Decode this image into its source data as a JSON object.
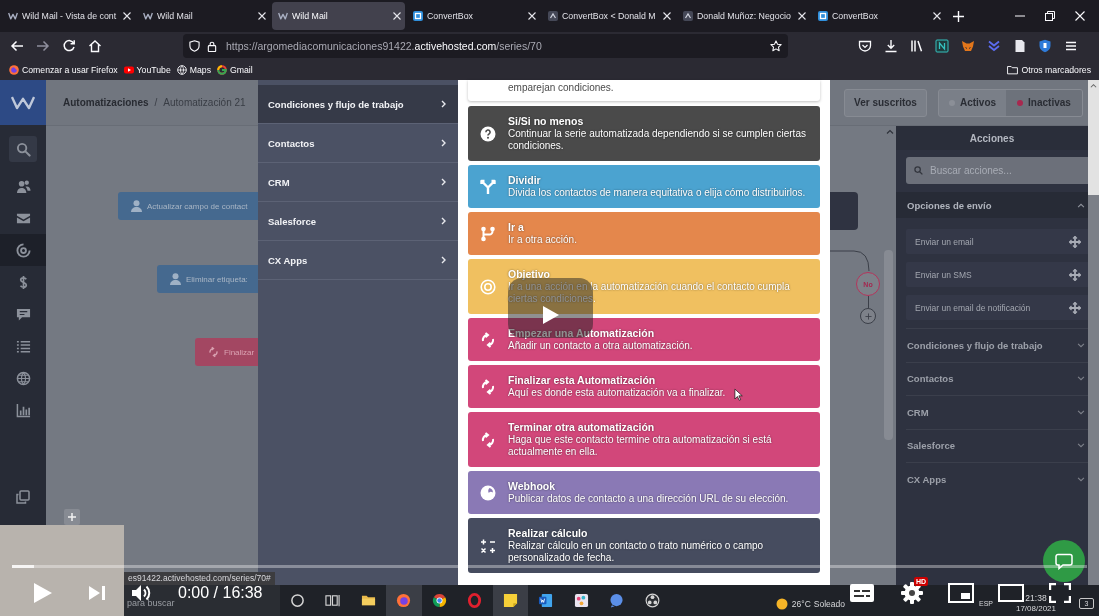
{
  "browser": {
    "tabs": [
      {
        "title": "Wild Mail - Vista de cont",
        "kind": "logo",
        "selected": false
      },
      {
        "title": "Wild Mail",
        "kind": "logo",
        "selected": false
      },
      {
        "title": "Wild Mail",
        "kind": "logo",
        "selected": true
      },
      {
        "title": "ConvertBox",
        "kind": "box",
        "selected": false
      },
      {
        "title": "ConvertBox < Donald M",
        "kind": "page",
        "selected": false
      },
      {
        "title": "Donald Muñoz: Negocio",
        "kind": "page",
        "selected": false
      },
      {
        "title": "ConvertBox",
        "kind": "box",
        "selected": false
      }
    ],
    "address": {
      "url": [
        {
          "text": "https://argomediacomunicaciones91422.",
          "highlight": false
        },
        {
          "text": "activehosted.com",
          "highlight": true
        },
        {
          "text": "/series/70",
          "highlight": false
        }
      ]
    },
    "bookmarks": [
      {
        "label": "Comenzar a usar Firefox",
        "kind": "fox"
      },
      {
        "label": "YouTube",
        "kind": "video"
      },
      {
        "label": "Maps",
        "kind": "globe"
      },
      {
        "label": "Gmail",
        "kind": "mail"
      }
    ],
    "other_bookmarks": "Otros marcadores"
  },
  "app": {
    "sidebar": {
      "items": [
        {
          "kind": "search",
          "selected": false
        },
        {
          "kind": "contacts",
          "selected": false
        },
        {
          "kind": "mail",
          "selected": false
        },
        {
          "kind": "automations",
          "selected": true
        },
        {
          "kind": "deals",
          "selected": false
        },
        {
          "kind": "conversations",
          "selected": false
        },
        {
          "kind": "lists",
          "selected": false
        },
        {
          "kind": "site",
          "selected": false
        },
        {
          "kind": "reports",
          "selected": false
        }
      ]
    },
    "breadcrumb": {
      "items": [
        "Automatizaciones",
        "Automatización 21"
      ],
      "separator": "/"
    },
    "canvas_nodes": [
      {
        "label": "Actualizar campo de contact",
        "kind": "contact",
        "color": "#45698f"
      },
      {
        "label": "Eliminar etiqueta:",
        "kind": "contact",
        "color": "#45698f"
      },
      {
        "label": "Finalizar",
        "kind": "cycle",
        "color": "#a34762"
      }
    ],
    "branch_label": "No",
    "header_actions": {
      "subscribers_button": "Ver suscritos",
      "status": [
        {
          "label": "Activos",
          "selected": false
        },
        {
          "label": "Inactivas",
          "selected": true
        }
      ]
    },
    "modal": {
      "categories": [
        {
          "label": "Condiciones y flujo de trabajo",
          "selected": true
        },
        {
          "label": "Contactos",
          "selected": false
        },
        {
          "label": "CRM",
          "selected": false
        },
        {
          "label": "Salesforce",
          "selected": false
        },
        {
          "label": "CX Apps",
          "selected": false
        }
      ],
      "partial_card": {
        "description": "emparejan condiciones."
      },
      "actions": [
        {
          "title": "Si/Si no menos",
          "description": "Continuar la serie automatizada dependiendo si se cumplen ciertas condiciones.",
          "kind": "question",
          "color": "#4a4a4a"
        },
        {
          "title": "Dividir",
          "description": "Divida los contactos de manera equitativa o elija cómo distribuirlos.",
          "kind": "split",
          "color": "#4ba3d0"
        },
        {
          "title": "Ir a",
          "description": "Ir a otra acción.",
          "kind": "branch",
          "color": "#e4874c"
        },
        {
          "title": "Objetivo",
          "description": "Ir a una acción en la automatización cuando el contacto cumpla ciertas condiciones.",
          "kind": "target",
          "color": "#f0c060"
        },
        {
          "title": "Empezar una Automatización",
          "description": "Añadir un contacto a otra automatización.",
          "kind": "cycle",
          "color": "#d2477a"
        },
        {
          "title": "Finalizar esta Automatización",
          "description": "Aquí es donde esta automatización va a finalizar.",
          "kind": "cycle",
          "color": "#d2477a"
        },
        {
          "title": "Terminar otra automatización",
          "description": "Haga que este contacto termine otra automatización si está actualmente en ella.",
          "kind": "cycle",
          "color": "#d2477a"
        },
        {
          "title": "Webhook",
          "description": "Publicar datos de contacto a una dirección URL de su elección.",
          "kind": "globe",
          "color": "#8a79b5"
        },
        {
          "title": "Realizar cálculo",
          "description": "Realizar cálculo en un contacto o trato numérico o campo personalizado de fecha.",
          "kind": "math",
          "color": "#464c5f"
        }
      ]
    },
    "actions_panel": {
      "title": "Acciones",
      "search": {
        "placeholder": "Buscar acciones..."
      },
      "sections": [
        {
          "label": "Opciones de envío",
          "expanded": true,
          "items": [
            "Enviar un email",
            "Enviar un SMS",
            "Enviar un email de notificación"
          ]
        },
        {
          "label": "Condiciones y flujo de trabajo",
          "expanded": false
        },
        {
          "label": "Contactos",
          "expanded": false
        },
        {
          "label": "CRM",
          "expanded": false
        },
        {
          "label": "Salesforce",
          "expanded": false
        },
        {
          "label": "CX Apps",
          "expanded": false
        }
      ]
    }
  },
  "status_tooltip": "es91422.activehosted.com/series/70#",
  "taskbar": {
    "search": {
      "placeholder": "para buscar"
    },
    "apps": [
      {
        "kind": "circle",
        "active": false
      },
      {
        "kind": "taskview",
        "active": false
      },
      {
        "kind": "folder",
        "active": false
      },
      {
        "kind": "fox",
        "active": true
      },
      {
        "kind": "wheel",
        "active": false
      },
      {
        "kind": "ring",
        "active": false
      },
      {
        "kind": "note",
        "active": true
      },
      {
        "kind": "doc",
        "active": false
      },
      {
        "kind": "paint",
        "active": false
      },
      {
        "kind": "chat",
        "active": false
      },
      {
        "kind": "aperture",
        "active": false
      }
    ],
    "weather": {
      "temperature": "26°C",
      "condition": "Soleado"
    },
    "language": "ESP",
    "time": "21:38",
    "date": "17/08/2021",
    "notifications": "3"
  },
  "player": {
    "progress": {
      "level": 0.02
    },
    "time": "0:00 / 16:38",
    "quality_badge": "HD"
  }
}
